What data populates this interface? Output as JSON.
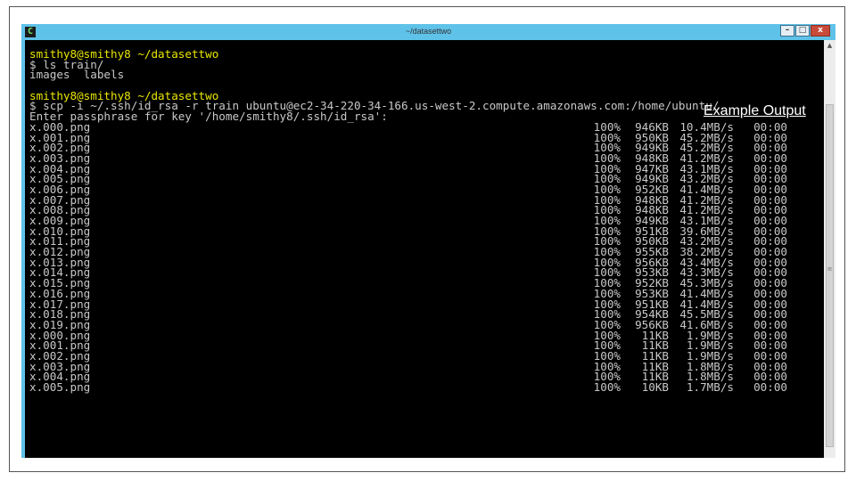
{
  "window": {
    "title": "~/datasettwo",
    "app_icon": "C",
    "minimize_label": "–",
    "maximize_label": "□",
    "close_label": "x"
  },
  "overlay_label": "Example Output",
  "terminal": {
    "prompt1": "smithy8@smithy8 ~/datasettwo",
    "cmd1": "$ ls train/",
    "out1": "images  labels",
    "prompt2": "smithy8@smithy8 ~/datasettwo",
    "cmd2": "$ scp -i ~/.ssh/id_rsa -r train ubuntu@ec2-34-220-34-166.us-west-2.compute.amazonaws.com:/home/ubuntu/.",
    "passphrase": "Enter passphrase for key '/home/smithy8/.ssh/id_rsa':",
    "transfers": [
      {
        "file": "x.000.png",
        "pct": "100%",
        "size": "946KB",
        "rate": "10.4MB/s",
        "time": "00:00"
      },
      {
        "file": "x.001.png",
        "pct": "100%",
        "size": "950KB",
        "rate": "45.2MB/s",
        "time": "00:00"
      },
      {
        "file": "x.002.png",
        "pct": "100%",
        "size": "949KB",
        "rate": "45.2MB/s",
        "time": "00:00"
      },
      {
        "file": "x.003.png",
        "pct": "100%",
        "size": "948KB",
        "rate": "41.2MB/s",
        "time": "00:00"
      },
      {
        "file": "x.004.png",
        "pct": "100%",
        "size": "947KB",
        "rate": "43.1MB/s",
        "time": "00:00"
      },
      {
        "file": "x.005.png",
        "pct": "100%",
        "size": "949KB",
        "rate": "43.2MB/s",
        "time": "00:00"
      },
      {
        "file": "x.006.png",
        "pct": "100%",
        "size": "952KB",
        "rate": "41.4MB/s",
        "time": "00:00"
      },
      {
        "file": "x.007.png",
        "pct": "100%",
        "size": "948KB",
        "rate": "41.2MB/s",
        "time": "00:00"
      },
      {
        "file": "x.008.png",
        "pct": "100%",
        "size": "948KB",
        "rate": "41.2MB/s",
        "time": "00:00"
      },
      {
        "file": "x.009.png",
        "pct": "100%",
        "size": "949KB",
        "rate": "43.1MB/s",
        "time": "00:00"
      },
      {
        "file": "x.010.png",
        "pct": "100%",
        "size": "951KB",
        "rate": "39.6MB/s",
        "time": "00:00"
      },
      {
        "file": "x.011.png",
        "pct": "100%",
        "size": "950KB",
        "rate": "43.2MB/s",
        "time": "00:00"
      },
      {
        "file": "x.012.png",
        "pct": "100%",
        "size": "955KB",
        "rate": "38.2MB/s",
        "time": "00:00"
      },
      {
        "file": "x.013.png",
        "pct": "100%",
        "size": "956KB",
        "rate": "43.4MB/s",
        "time": "00:00"
      },
      {
        "file": "x.014.png",
        "pct": "100%",
        "size": "953KB",
        "rate": "43.3MB/s",
        "time": "00:00"
      },
      {
        "file": "x.015.png",
        "pct": "100%",
        "size": "952KB",
        "rate": "45.3MB/s",
        "time": "00:00"
      },
      {
        "file": "x.016.png",
        "pct": "100%",
        "size": "953KB",
        "rate": "41.4MB/s",
        "time": "00:00"
      },
      {
        "file": "x.017.png",
        "pct": "100%",
        "size": "951KB",
        "rate": "41.4MB/s",
        "time": "00:00"
      },
      {
        "file": "x.018.png",
        "pct": "100%",
        "size": "954KB",
        "rate": "45.5MB/s",
        "time": "00:00"
      },
      {
        "file": "x.019.png",
        "pct": "100%",
        "size": "956KB",
        "rate": "41.6MB/s",
        "time": "00:00"
      },
      {
        "file": "x.000.png",
        "pct": "100%",
        "size": "11KB",
        "rate": "1.9MB/s",
        "time": "00:00"
      },
      {
        "file": "x.001.png",
        "pct": "100%",
        "size": "11KB",
        "rate": "1.9MB/s",
        "time": "00:00"
      },
      {
        "file": "x.002.png",
        "pct": "100%",
        "size": "11KB",
        "rate": "1.9MB/s",
        "time": "00:00"
      },
      {
        "file": "x.003.png",
        "pct": "100%",
        "size": "11KB",
        "rate": "1.8MB/s",
        "time": "00:00"
      },
      {
        "file": "x.004.png",
        "pct": "100%",
        "size": "11KB",
        "rate": "1.8MB/s",
        "time": "00:00"
      },
      {
        "file": "x.005.png",
        "pct": "100%",
        "size": "10KB",
        "rate": "1.7MB/s",
        "time": "00:00"
      }
    ]
  },
  "colors": {
    "prompt": "#e8e600",
    "text": "#c8c8c8",
    "background": "#000000",
    "window_chrome": "#5fc2e9"
  }
}
